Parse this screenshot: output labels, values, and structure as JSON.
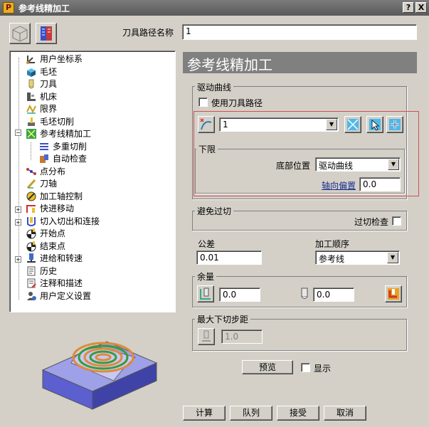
{
  "window": {
    "title": "参考线精加工",
    "help": "?",
    "close": "X"
  },
  "header": {
    "name_label": "刀具路径名称",
    "name_value": "1"
  },
  "tree": {
    "items": [
      {
        "label": "用户坐标系",
        "icon": "ucs-icon"
      },
      {
        "label": "毛坯",
        "icon": "block-icon"
      },
      {
        "label": "刀具",
        "icon": "tool-icon"
      },
      {
        "label": "机床",
        "icon": "machine-icon"
      },
      {
        "label": "限界",
        "icon": "limits-icon"
      },
      {
        "label": "毛坯切削",
        "icon": "stock-cut-icon"
      },
      {
        "label": "参考线精加工",
        "icon": "pattern-finish-icon"
      },
      {
        "label": "多重切削",
        "icon": "multiple-cuts-icon"
      },
      {
        "label": "自动检查",
        "icon": "auto-check-icon"
      },
      {
        "label": "点分布",
        "icon": "point-distribution-icon"
      },
      {
        "label": "刀轴",
        "icon": "tool-axis-icon"
      },
      {
        "label": "加工轴控制",
        "icon": "axis-control-icon"
      },
      {
        "label": "快进移动",
        "icon": "rapid-move-icon"
      },
      {
        "label": "切入切出和连接",
        "icon": "leads-links-icon"
      },
      {
        "label": "开始点",
        "icon": "start-point-icon"
      },
      {
        "label": "结束点",
        "icon": "end-point-icon"
      },
      {
        "label": "进给和转速",
        "icon": "feeds-speeds-icon"
      },
      {
        "label": "历史",
        "icon": "history-icon"
      },
      {
        "label": "注释和描述",
        "icon": "notes-icon"
      },
      {
        "label": "用户定义设置",
        "icon": "user-settings-icon"
      }
    ]
  },
  "panel": {
    "title": "参考线精加工"
  },
  "drive": {
    "group_label": "驱动曲线",
    "use_toolpath_label": "使用刀具路径",
    "use_toolpath_checked": false,
    "pattern_value": "1"
  },
  "lower": {
    "group_label": "下限",
    "bottom_label": "底部位置",
    "bottom_value": "驱动曲线",
    "offset_label": "轴向偏置",
    "offset_value": "0.0"
  },
  "gouge": {
    "group_label": "避免过切",
    "check_label": "过切检查",
    "checked": false
  },
  "tolerance": {
    "label": "公差",
    "value": "0.01"
  },
  "order": {
    "label": "加工顺序",
    "value": "参考线"
  },
  "allowance": {
    "group_label": "余量",
    "radial_value": "0.0",
    "axial_value": "0.0"
  },
  "stepdown": {
    "group_label": "最大下切步距",
    "value": "1.0"
  },
  "preview": {
    "button_label": "预览",
    "show_label": "显示",
    "show_checked": false
  },
  "footer": {
    "calculate": "计算",
    "queue": "队列",
    "accept": "接受",
    "cancel": "取消"
  },
  "colors": {
    "highlight_border": "#d05050",
    "title_bg": "#808080",
    "link": "#1a2d8f"
  }
}
